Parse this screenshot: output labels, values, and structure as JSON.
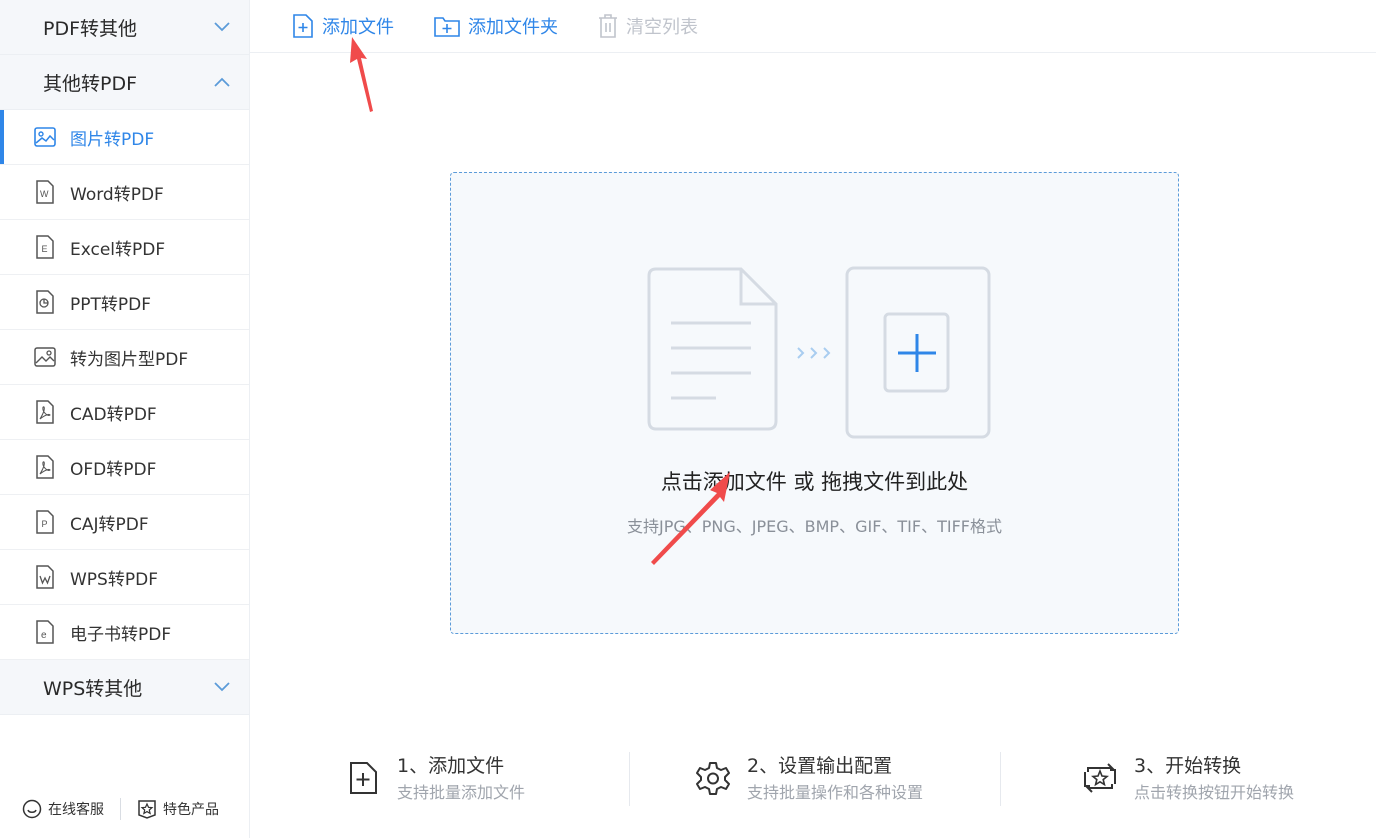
{
  "sidebar": {
    "groups": [
      {
        "label": "PDF转其他",
        "state": "collapsed"
      },
      {
        "label": "其他转PDF",
        "state": "expanded"
      },
      {
        "label": "WPS转其他",
        "state": "collapsed"
      }
    ],
    "items": [
      {
        "label": "图片转PDF",
        "icon": "image-icon",
        "active": true
      },
      {
        "label": "Word转PDF",
        "icon": "word-doc-icon"
      },
      {
        "label": "Excel转PDF",
        "icon": "excel-doc-icon"
      },
      {
        "label": "PPT转PDF",
        "icon": "ppt-doc-icon"
      },
      {
        "label": "转为图片型PDF",
        "icon": "image-icon"
      },
      {
        "label": "CAD转PDF",
        "icon": "pdf-doc-icon"
      },
      {
        "label": "OFD转PDF",
        "icon": "pdf-doc-icon"
      },
      {
        "label": "CAJ转PDF",
        "icon": "caj-doc-icon"
      },
      {
        "label": "WPS转PDF",
        "icon": "wps-doc-icon"
      },
      {
        "label": "电子书转PDF",
        "icon": "ebook-doc-icon"
      }
    ],
    "footer": {
      "service": "在线客服",
      "products": "特色产品"
    }
  },
  "toolbar": {
    "add_file": "添加文件",
    "add_folder": "添加文件夹",
    "clear_list": "清空列表"
  },
  "dropzone": {
    "title": "点击添加文件 或 拖拽文件到此处",
    "subtitle": "支持JPG、PNG、JPEG、BMP、GIF、TIF、TIFF格式"
  },
  "steps": [
    {
      "title": "1、添加文件",
      "desc": "支持批量添加文件",
      "icon": "add-file-icon"
    },
    {
      "title": "2、设置输出配置",
      "desc": "支持批量操作和各种设置",
      "icon": "gear-icon"
    },
    {
      "title": "3、开始转换",
      "desc": "点击转换按钮开始转换",
      "icon": "convert-icon"
    }
  ],
  "colors": {
    "accent": "#2f86e8",
    "arrow": "#f04b4b",
    "sidebar_group_bg": "#f5f7fa",
    "dropzone_bg": "#f6f9fc"
  }
}
